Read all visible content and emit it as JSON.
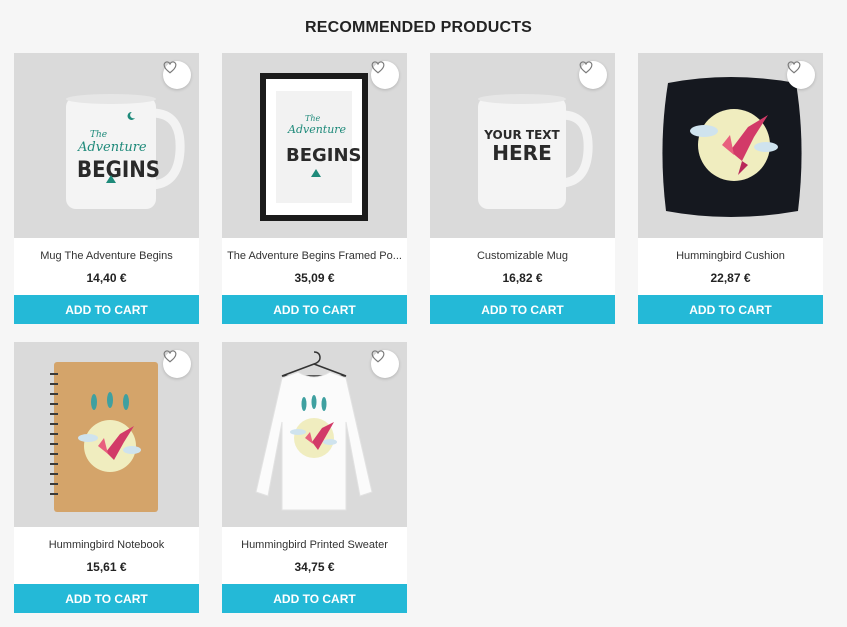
{
  "section": {
    "title": "RECOMMENDED PRODUCTS"
  },
  "products": [
    {
      "name": "Mug The Adventure Begins",
      "price": "14,40 €",
      "cart_label": "ADD TO CART",
      "image": "mug-adventure-begins"
    },
    {
      "name": "The Adventure Begins Framed Po...",
      "price": "35,09 €",
      "cart_label": "ADD TO CART",
      "image": "framed-poster-adventure"
    },
    {
      "name": "Customizable Mug",
      "price": "16,82 €",
      "cart_label": "ADD TO CART",
      "image": "mug-your-text-here"
    },
    {
      "name": "Hummingbird Cushion",
      "price": "22,87 €",
      "cart_label": "ADD TO CART",
      "image": "hummingbird-cushion"
    },
    {
      "name": "Hummingbird Notebook",
      "price": "15,61 €",
      "cart_label": "ADD TO CART",
      "image": "hummingbird-notebook"
    },
    {
      "name": "Hummingbird Printed Sweater",
      "price": "34,75 €",
      "cart_label": "ADD TO CART",
      "image": "hummingbird-sweater"
    }
  ],
  "artwork": {
    "the": "The",
    "adventure": "Adventure",
    "begins": "BEGINS",
    "your_text_line1": "YOUR TEXT",
    "your_text_line2": "HERE"
  },
  "colors": {
    "accent": "#24b9d7",
    "thumb_background": "#dadada",
    "artwork_teal": "#1e8a7a",
    "artwork_dark": "#2a2a2a"
  },
  "icons": {
    "wishlist": "heart-outline-icon"
  }
}
